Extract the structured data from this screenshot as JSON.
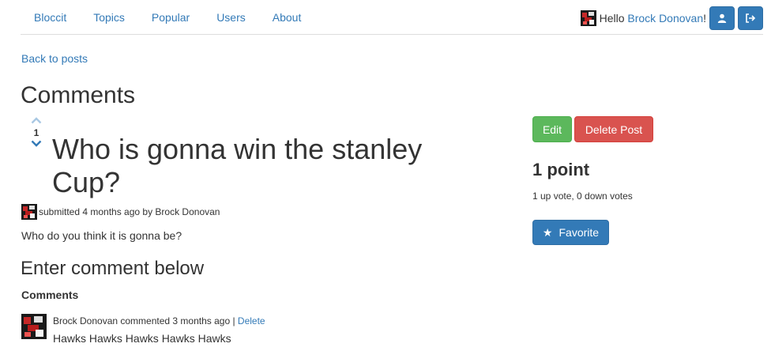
{
  "nav": {
    "links": [
      "Bloccit",
      "Topics",
      "Popular",
      "Users",
      "About"
    ],
    "hello_prefix": "Hello",
    "user_name": "Brock Donovan",
    "hello_suffix": "!",
    "profile_icon": "user-icon",
    "signout_icon": "sign-out-icon"
  },
  "back_link": "Back to posts",
  "page_heading": "Comments",
  "post": {
    "vote_count": "1",
    "title": "Who is gonna win the stanley Cup?",
    "meta": "submitted 4 months ago by Brock Donovan",
    "body": "Who do you think it is gonna be?"
  },
  "sidebar": {
    "edit_label": "Edit",
    "delete_label": "Delete Post",
    "points": "1 point",
    "votes_detail": "1 up vote, 0 down votes",
    "favorite_label": "Favorite"
  },
  "comment_form_heading": "Enter comment below",
  "comments_label": "Comments",
  "comments": [
    {
      "meta": "Brock Donovan commented 3 months ago",
      "separator": " | ",
      "delete_label": "Delete",
      "body": "Hawks Hawks Hawks Hawks Hawks"
    }
  ],
  "colors": {
    "primary": "#337ab7",
    "success": "#5cb85c",
    "danger": "#d9534f"
  }
}
